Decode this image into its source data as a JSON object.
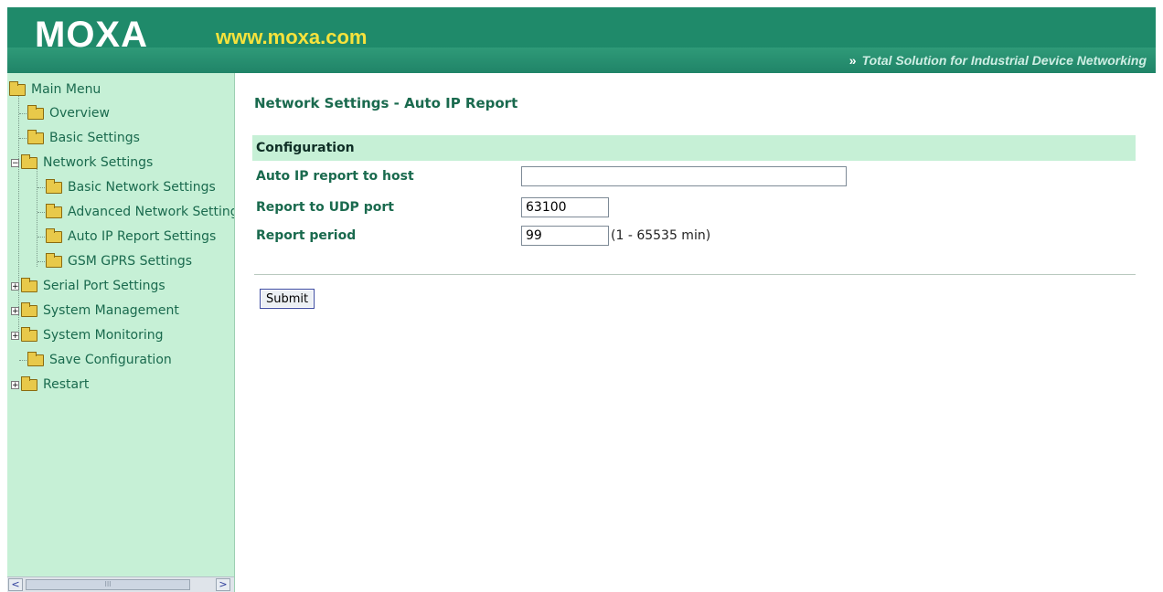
{
  "header": {
    "logo": "MOXA",
    "site": "www.moxa.com",
    "tagline_arrows": "»",
    "tagline": "Total Solution for Industrial Device Networking"
  },
  "nav": {
    "root": "Main Menu",
    "items": [
      {
        "label": "Overview"
      },
      {
        "label": "Basic Settings"
      },
      {
        "label": "Network Settings"
      },
      {
        "label": "Basic Network Settings"
      },
      {
        "label": "Advanced Network Settings"
      },
      {
        "label": "Auto IP Report Settings"
      },
      {
        "label": "GSM GPRS Settings"
      },
      {
        "label": "Serial Port Settings"
      },
      {
        "label": "System Management"
      },
      {
        "label": "System Monitoring"
      },
      {
        "label": "Save Configuration"
      },
      {
        "label": "Restart"
      }
    ],
    "scroll_left": "<",
    "scroll_right": ">",
    "scroll_grip": "III"
  },
  "main": {
    "title": "Network Settings - Auto IP Report",
    "section": "Configuration",
    "fields": {
      "host": {
        "label": "Auto IP report to host",
        "value": ""
      },
      "udp": {
        "label": "Report to UDP port",
        "value": "63100"
      },
      "period": {
        "label": "Report period",
        "value": "99",
        "unit": "(1 - 65535 min)"
      }
    },
    "submit": "Submit"
  },
  "colors": {
    "banner": "#1f8a6a",
    "nav_bg": "#c6f0d6",
    "accent_text": "#1a6a4e",
    "site_text": "#f6e23c"
  }
}
